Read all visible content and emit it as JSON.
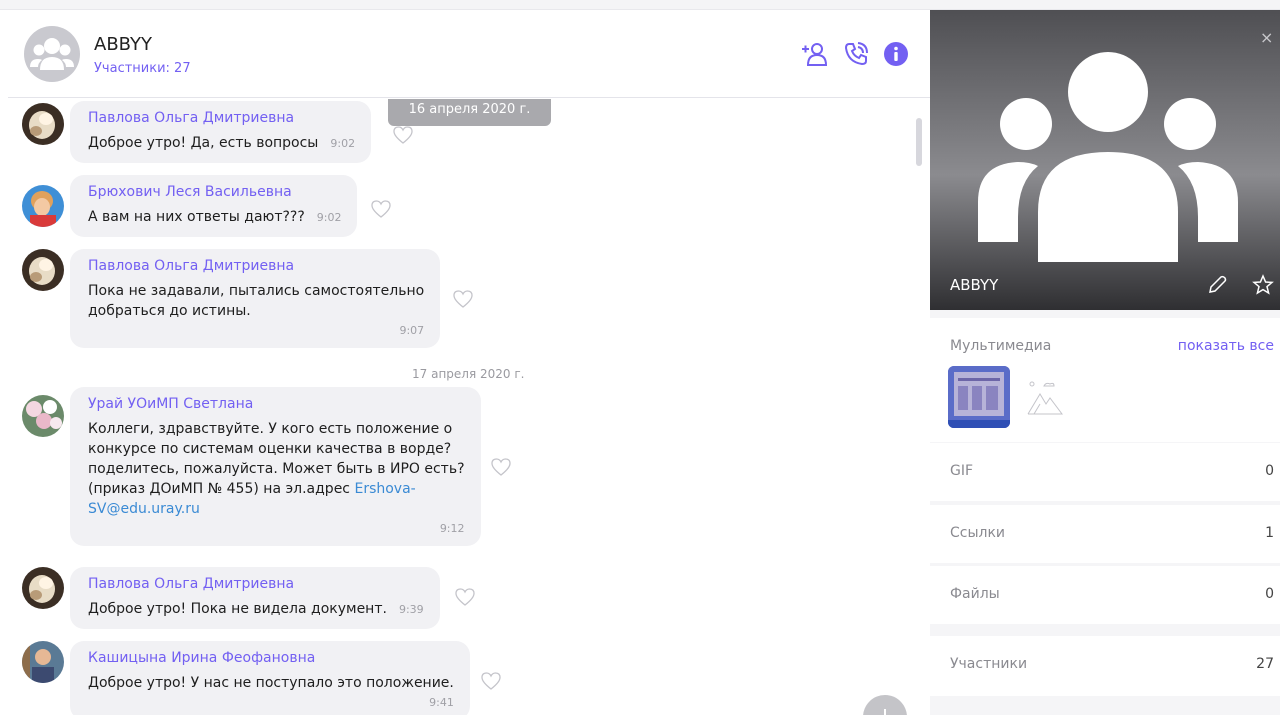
{
  "chat": {
    "title": "ABBYY",
    "subtitle": "Участники: 27",
    "date_pill": "16 апреля 2020 г.",
    "date_label": "17 апреля 2020 г.",
    "messages": [
      {
        "author": "Павлова Ольга Дмитриевна",
        "text": "Доброе утро! Да, есть вопросы",
        "time": "9:02"
      },
      {
        "author": "Брюхович Леся Васильевна",
        "text": "А вам на них ответы дают???",
        "time": "9:02"
      },
      {
        "author": "Павлова Ольга Дмитриевна",
        "line1": "Пока не задавали, пытались самостоятельно",
        "line2": "добраться до истины.",
        "time": "9:07"
      },
      {
        "author": "Урай УОиМП Светлана",
        "line1": "Коллеги, здравствуйте. У кого есть положение о",
        "line2": "конкурсе по системам оценки качества в ворде?",
        "line3": "поделитесь, пожалуйста. Может быть в ИРО есть?",
        "line4": "(приказ ДОиМП № 455) на эл.адрес ",
        "link1": "Ershova-",
        "link2": "SV@edu.uray.ru",
        "time": "9:12"
      },
      {
        "author": "Павлова Ольга Дмитриевна",
        "text": "Доброе утро! Пока не видела документ.",
        "time": "9:39"
      },
      {
        "author": "Кашицына Ирина Феофановна",
        "text": "Доброе утро! У нас не поступало это положение.",
        "time": "9:41"
      }
    ]
  },
  "panel": {
    "cover_title": "ABBYY",
    "close_glyph": "×",
    "media_title": "Мультимедиа",
    "media_showall": "показать все",
    "rows": [
      {
        "label": "GIF",
        "count": "0"
      },
      {
        "label": "Ссылки",
        "count": "1"
      },
      {
        "label": "Файлы",
        "count": "0"
      },
      {
        "label": "Участники",
        "count": "27"
      }
    ]
  },
  "colors": {
    "accent": "#7360f2",
    "bubble": "#f1f1f4",
    "link": "#3a8ad4"
  }
}
